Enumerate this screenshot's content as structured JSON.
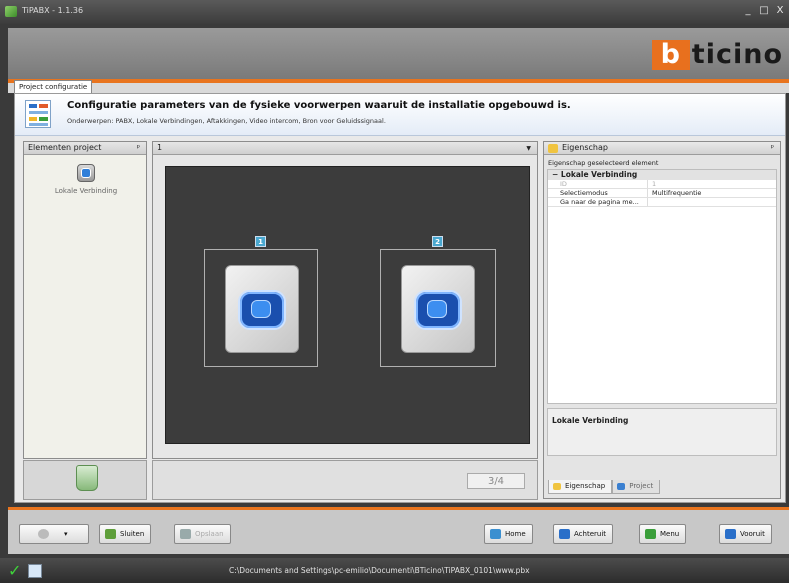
{
  "window": {
    "title": "TiPABX - 1.1.36",
    "controls": [
      "_",
      "□",
      "X"
    ]
  },
  "brand": {
    "logo_initial": "b",
    "logo_rest": "ticino",
    "accent": "#e8741e"
  },
  "tab": {
    "label": "Project configuratie"
  },
  "banner": {
    "title": "Configuratie parameters van de fysieke voorwerpen waaruit de installatie opgebouwd is.",
    "subtitle": "Onderwerpen: PABX, Lokale Verbindingen, Aftakkingen, Video intercom, Bron voor Geluidssignaal."
  },
  "left_panel": {
    "title": "Elementen project",
    "pin": "ᵖ",
    "items": [
      {
        "label": "Lokale Verbinding",
        "icon": "local-connection-icon"
      }
    ]
  },
  "center_panel": {
    "selector_value": "1",
    "dropdown": "▼",
    "devices": [
      {
        "number": "1"
      },
      {
        "number": "2"
      }
    ],
    "page_indicator": "3/4"
  },
  "right_panel": {
    "title": "Eigenschap",
    "pin": "ᵖ",
    "caption": "Eigenschap geselecteerd element",
    "category": "Lokale Verbinding",
    "category_toggle": "−",
    "rows": [
      {
        "key": "ID",
        "value": "1",
        "disabled": true
      },
      {
        "key": "Selectiemodus",
        "value": "Multifrequentie",
        "disabled": false
      },
      {
        "key": "Ga naar de pagina me...",
        "value": "",
        "disabled": false
      }
    ],
    "description": "Lokale Verbinding",
    "tabs": [
      {
        "label": "Eigenschap",
        "active": true
      },
      {
        "label": "Project",
        "active": false
      }
    ]
  },
  "toolbar": {
    "gear_arrow": "▾",
    "sluiten": "Sluiten",
    "opslaan": "Opslaan",
    "home": "Home",
    "achteruit": "Achteruit",
    "menu": "Menu",
    "vooruit": "Vooruit"
  },
  "status": {
    "path": "C:\\Documents and Settings\\pc-emilio\\Documenti\\BTicino\\TiPABX_0101\\www.pbx"
  }
}
